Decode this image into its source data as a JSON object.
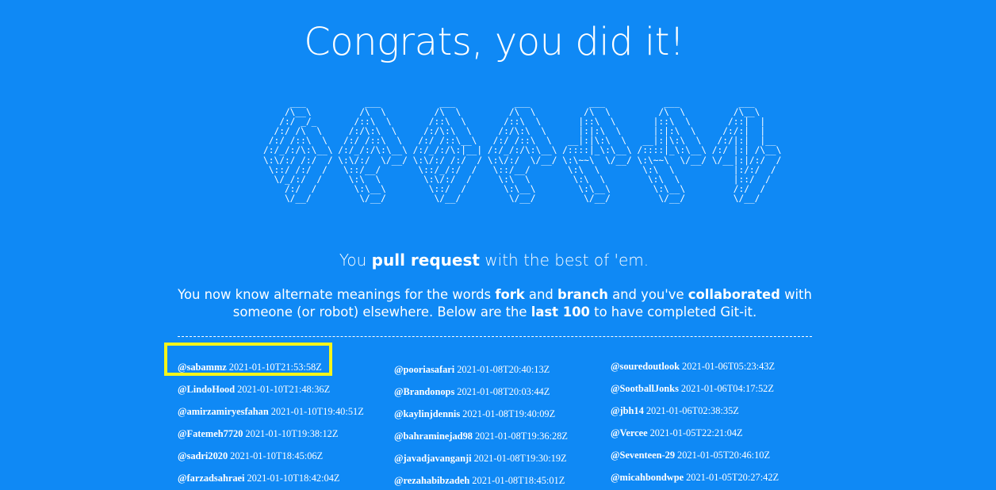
{
  "page": {
    "title": "Congrats, you did it!",
    "ascii_art": "     ___           ___           ___           ___           ___           ___           ___     \n    /\\__\\         /\\  \\         /\\  \\         /\\  \\         /\\  \\         /\\  \\         /\\__\\    \n   /:/ _/_       /::\\  \\       /::\\  \\       /::\\  \\       |::\\  \\       |::\\  \\       /::|  |   \n  /:/ /\\  \\     /:/\\:\\  \\     /:/\\:\\  \\     /:/\\:\\  \\      |:|:\\  \\      |:|:\\  \\     /:/:|  |   \n /:/ /::\\  \\   /:/ /::\\  \\   /:/ /::\\__\\   /:/ /::\\  \\   __|:|\\:\\  \\   __|:|\\:\\  \\   /:/|:|  |__ \n/:/_/:/\\:\\__\\ /:/_/:/\\:\\__\\ /:/_/:/\\:|__| /:/_/:/\\:\\__\\ /::::|_\\:\\__\\ /::::|_\\:\\__\\ /:/ |:| /\\__\\\n\\:\\/:/ /:/  / \\:\\/:/  \\/__/ \\:\\/:/ /:/  / \\:\\/:/  \\/__/ \\:\\~~\\  \\/__/ \\:\\~~\\  \\/__/ \\/__|:|/:/  /\n \\::/ /:/  /   \\::/__/       \\::/_/:/  /   \\::/__/       \\:\\  \\        \\:\\  \\           |:/:/  / \n  \\/_/:/  /     \\:\\  \\        \\:\\/:/  /     \\:\\  \\        \\:\\  \\        \\:\\  \\          |::/  /  \n    /:/  /       \\:\\__\\        \\::/  /       \\:\\__\\        \\:\\__\\        \\:\\__\\         /:/  /   \n    \\/__/         \\/__/         \\/__/         \\/__/         \\/__/         \\/__/         \\/__/    ",
    "lead": {
      "prefix": "You ",
      "bold": "pull request",
      "suffix": " with the best of 'em."
    },
    "description": {
      "part1": "You now know alternate meanings for the words ",
      "fork": "fork",
      "part2": " and ",
      "branch": "branch",
      "part3": " and you've ",
      "collaborated": "collaborated",
      "part4": " with someone (or robot) elsewhere. Below are the ",
      "last100": "last 100",
      "part5": " to have completed Git-it."
    },
    "highlight_color": "#f5f51a",
    "background_color": "#0f89f5"
  },
  "completers": {
    "col1": [
      {
        "user": "@sabammz",
        "time": "2021-01-10T21:53:58Z"
      },
      {
        "user": "@LindoHood",
        "time": "2021-01-10T21:48:36Z"
      },
      {
        "user": "@amirzamiryesfahan",
        "time": "2021-01-10T19:40:51Z"
      },
      {
        "user": "@Fatemeh7720",
        "time": "2021-01-10T19:38:12Z"
      },
      {
        "user": "@sadri2020",
        "time": "2021-01-10T18:45:06Z"
      },
      {
        "user": "@farzadsahraei",
        "time": "2021-01-10T18:42:04Z"
      }
    ],
    "col2": [
      {
        "user": "@pooriasafari",
        "time": "2021-01-08T20:40:13Z"
      },
      {
        "user": "@Brandonops",
        "time": "2021-01-08T20:03:44Z"
      },
      {
        "user": "@kaylinjdennis",
        "time": "2021-01-08T19:40:09Z"
      },
      {
        "user": "@bahraminejad98",
        "time": "2021-01-08T19:36:28Z"
      },
      {
        "user": "@javadjavanganji",
        "time": "2021-01-08T19:30:19Z"
      },
      {
        "user": "@rezahabibzadeh",
        "time": "2021-01-08T18:45:01Z"
      }
    ],
    "col3": [
      {
        "user": "@souredoutlook",
        "time": "2021-01-06T05:23:43Z"
      },
      {
        "user": "@SootballJonks",
        "time": "2021-01-06T04:17:52Z"
      },
      {
        "user": "@jbh14",
        "time": "2021-01-06T02:38:35Z"
      },
      {
        "user": "@Vercee",
        "time": "2021-01-05T22:21:04Z"
      },
      {
        "user": "@Seventeen-29",
        "time": "2021-01-05T20:46:10Z"
      },
      {
        "user": "@micahbondwpe",
        "time": "2021-01-05T20:27:42Z"
      }
    ]
  }
}
